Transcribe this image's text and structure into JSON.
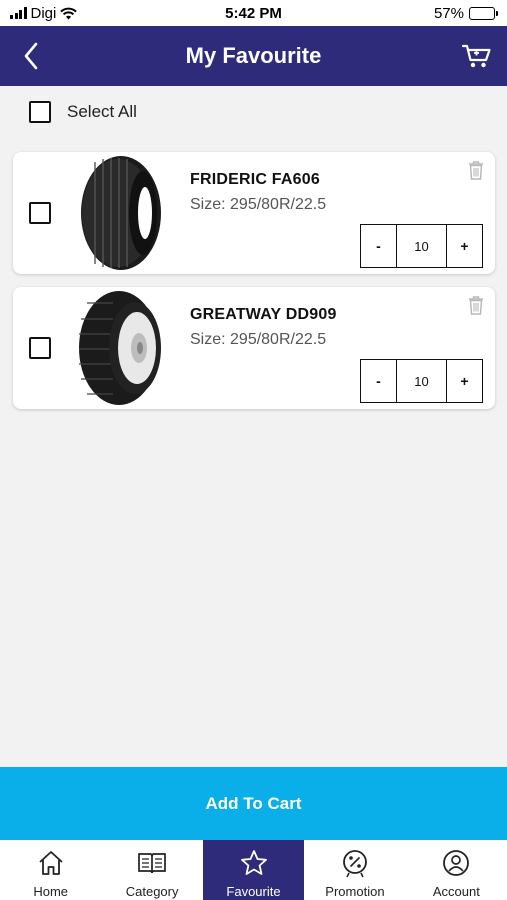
{
  "status_bar": {
    "carrier": "Digi",
    "time": "5:42 PM",
    "battery": "57%",
    "battery_level": 0.57
  },
  "header": {
    "title": "My Favourite",
    "back_icon": "chevron-left-icon",
    "cart_icon": "cart-icon"
  },
  "select_all": {
    "label": "Select All"
  },
  "products": [
    {
      "name": "FRIDERIC FA606",
      "size": "Size: 295/80R/22.5",
      "quantity": "10",
      "minus": "-",
      "plus": "+"
    },
    {
      "name": "GREATWAY DD909",
      "size": "Size: 295/80R/22.5",
      "quantity": "10",
      "minus": "-",
      "plus": "+"
    }
  ],
  "add_to_cart": {
    "label": "Add To Cart"
  },
  "bottom_nav": [
    {
      "label": "Home",
      "icon": "home-icon"
    },
    {
      "label": "Category",
      "icon": "book-icon"
    },
    {
      "label": "Favourite",
      "icon": "star-icon",
      "active": true
    },
    {
      "label": "Promotion",
      "icon": "percent-badge-icon"
    },
    {
      "label": "Account",
      "icon": "user-circle-icon"
    }
  ],
  "colors": {
    "header": "#2e2b7a",
    "button": "#0aaee8",
    "active_nav": "#2e2b7a"
  }
}
